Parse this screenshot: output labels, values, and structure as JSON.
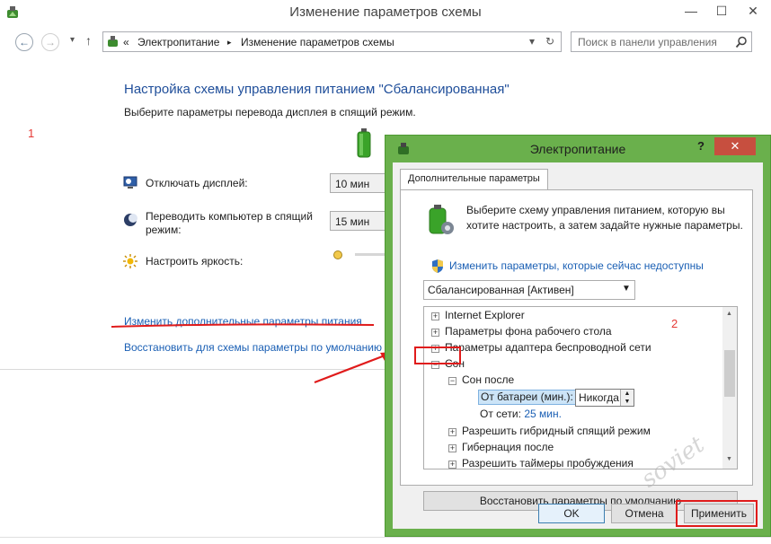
{
  "window": {
    "title": "Изменение параметров схемы",
    "minimize": "—",
    "maximize": "☐",
    "close": "✕"
  },
  "nav": {
    "back": "←",
    "forward": "→",
    "up": "↑",
    "breadcrumb_prefix": "«",
    "breadcrumb_1": "Электропитание",
    "breadcrumb_sep": "▸",
    "breadcrumb_2": "Изменение параметров схемы",
    "dropdown": "▾",
    "refresh": "↻",
    "search_placeholder": "Поиск в панели управления"
  },
  "main": {
    "heading": "Настройка схемы управления питанием \"Сбалансированная\"",
    "subtitle": "Выберите параметры перевода дисплея в спящий режим.",
    "annotation_1": "1",
    "options": [
      {
        "label": "Отключать дисплей:",
        "value": "10 мин"
      },
      {
        "label": "Переводить компьютер в спящий режим:",
        "value": "15 мин"
      },
      {
        "label": "Настроить яркость:"
      }
    ],
    "link_advanced": "Изменить дополнительные параметры питания",
    "link_restore": "Восстановить для схемы параметры по умолчанию"
  },
  "dialog": {
    "title": "Электропитание",
    "help": "?",
    "close": "✕",
    "tab": "Дополнительные параметры",
    "description": "Выберите схему управления питанием, которую вы хотите настроить, а затем задайте нужные параметры.",
    "change_link": "Изменить параметры, которые сейчас недоступны",
    "scheme": "Сбалансированная [Активен]",
    "annotation_2": "2",
    "tree": {
      "internet_explorer": "Internet Explorer",
      "desktop_background": "Параметры фона рабочего стола",
      "wireless_adapter": "Параметры адаптера беспроводной сети",
      "sleep": "Сон",
      "sleep_after": "Сон после",
      "on_battery_label": "От батареи (мин.):",
      "on_battery_value": "Никогда",
      "on_ac_label": "От сети:",
      "on_ac_value": "25 мин.",
      "hybrid_sleep": "Разрешить гибридный спящий режим",
      "hibernate": "Гибернация после",
      "wake_timers": "Разрешить таймеры пробуждения"
    },
    "restore_defaults": "Восстановить параметры по умолчанию",
    "ok": "OK",
    "cancel": "Отмена",
    "apply": "Применить"
  }
}
